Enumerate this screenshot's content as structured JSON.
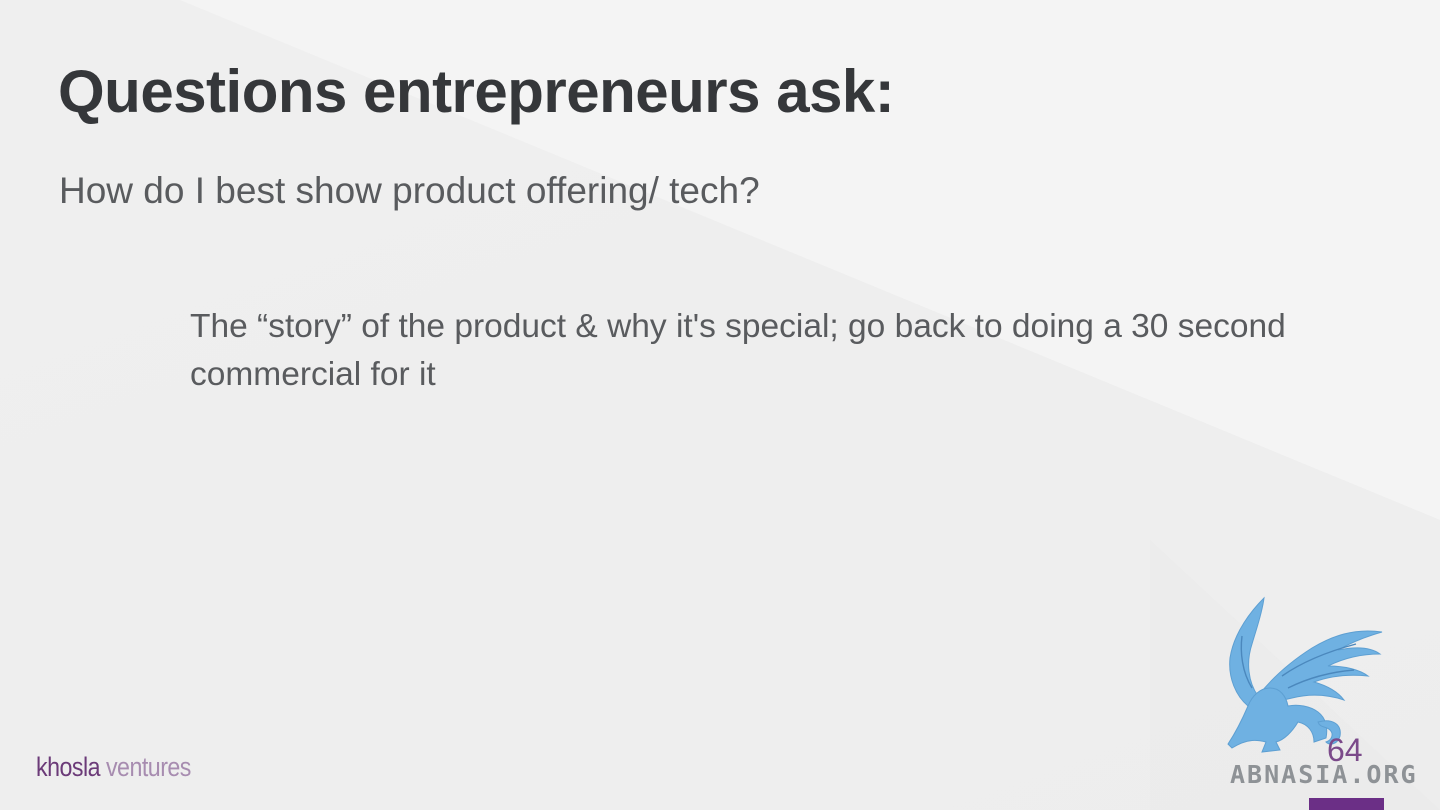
{
  "slide": {
    "title": "Questions entrepreneurs ask:",
    "question": "How do I best show product offering/ tech?",
    "answer": "The “story” of the product & why it's special; go back to doing a 30 second commercial for it",
    "page_number": "64"
  },
  "branding": {
    "logo_word1": "khosla",
    "logo_word2": " ventures",
    "watermark": "ABNASIA.ORG",
    "watermark_icon": "griffin-icon"
  },
  "colors": {
    "title": "#35373a",
    "body_text": "#595b5e",
    "accent_purple": "#6b3a78",
    "accent_bar": "#6b2f86",
    "watermark_blue": "#6fb1e2"
  }
}
